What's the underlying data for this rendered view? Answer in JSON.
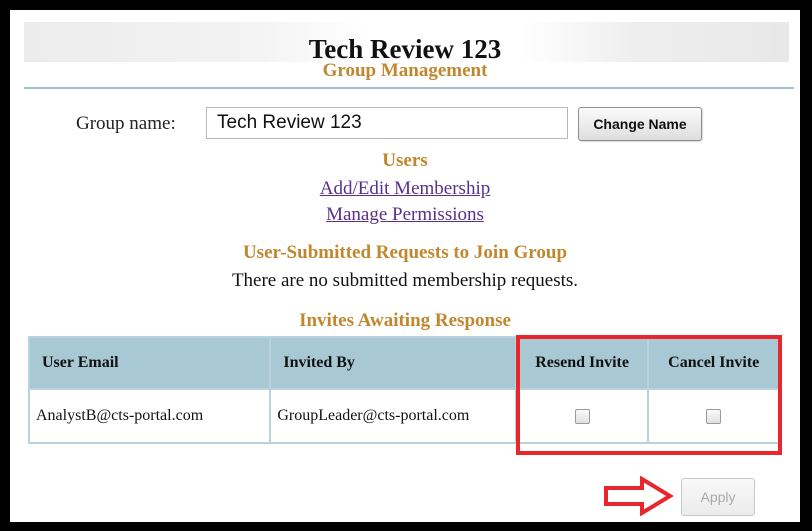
{
  "header": {
    "title": "Tech Review 123",
    "subtitle": "Group Management"
  },
  "group": {
    "label": "Group name:",
    "value": "Tech Review 123",
    "change_button": "Change Name"
  },
  "users": {
    "heading": "Users",
    "links": [
      "Add/Edit Membership",
      "Manage Permissions"
    ]
  },
  "requests": {
    "heading": "User-Submitted Requests to Join Group",
    "empty_message": "There are no submitted membership requests."
  },
  "invites": {
    "heading": "Invites Awaiting Response",
    "columns": [
      "User Email",
      "Invited By",
      "Resend Invite",
      "Cancel Invite"
    ],
    "rows": [
      {
        "user_email": "AnalystB@cts-portal.com",
        "invited_by": "GroupLeader@cts-portal.com",
        "resend_checked": false,
        "cancel_checked": false
      }
    ]
  },
  "apply_button": "Apply",
  "colors": {
    "accent": "#c0872f",
    "link": "#5a2f8a",
    "table_header": "#a8c8d4",
    "highlight": "#e8262b"
  }
}
